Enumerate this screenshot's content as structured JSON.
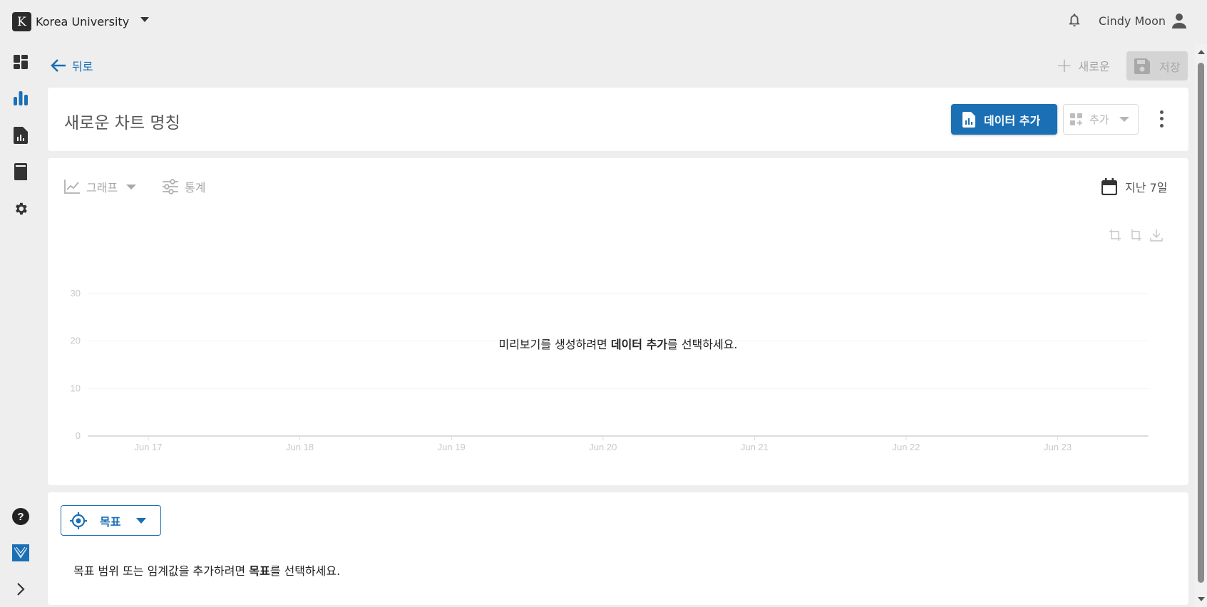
{
  "header": {
    "org_logo_letter": "K",
    "org_name": "Korea University",
    "user_name": "Cindy Moon"
  },
  "rail": {
    "items": [
      "dashboard-icon",
      "bar-chart-icon",
      "report-icon",
      "book-icon",
      "settings-icon"
    ],
    "bottom": [
      "help-icon",
      "brand-logo-icon",
      "expand-icon"
    ]
  },
  "nav": {
    "back_label": "뒤로",
    "new_label": "새로운",
    "save_label": "저장"
  },
  "title_card": {
    "chart_title": "새로운 차트 명칭",
    "add_data_label": "데이터 추가",
    "add_label": "추가"
  },
  "toolbar": {
    "graph_label": "그래프",
    "stats_label": "통계",
    "date_range_label": "지난 7일"
  },
  "empty_state": {
    "prefix": "미리보기를 생성하려면 ",
    "bold": "데이터 추가",
    "suffix": "를 선택하세요."
  },
  "goal": {
    "button_label": "목표",
    "msg_prefix": "목표 범위 또는 임계값을 추가하려면 ",
    "msg_bold": "목표",
    "msg_suffix": "를 선택하세요."
  },
  "colors": {
    "accent": "#1a6fb5",
    "background": "#eeeeee",
    "disabled": "#a8a8a8"
  },
  "chart_data": {
    "type": "line",
    "categories": [
      "Jun 17",
      "Jun 18",
      "Jun 19",
      "Jun 20",
      "Jun 21",
      "Jun 22",
      "Jun 23"
    ],
    "series": [],
    "yticks": [
      "0",
      "10",
      "20",
      "30"
    ],
    "ylim": [
      0,
      30
    ],
    "grid": true,
    "title": "",
    "xlabel": "",
    "ylabel": ""
  }
}
